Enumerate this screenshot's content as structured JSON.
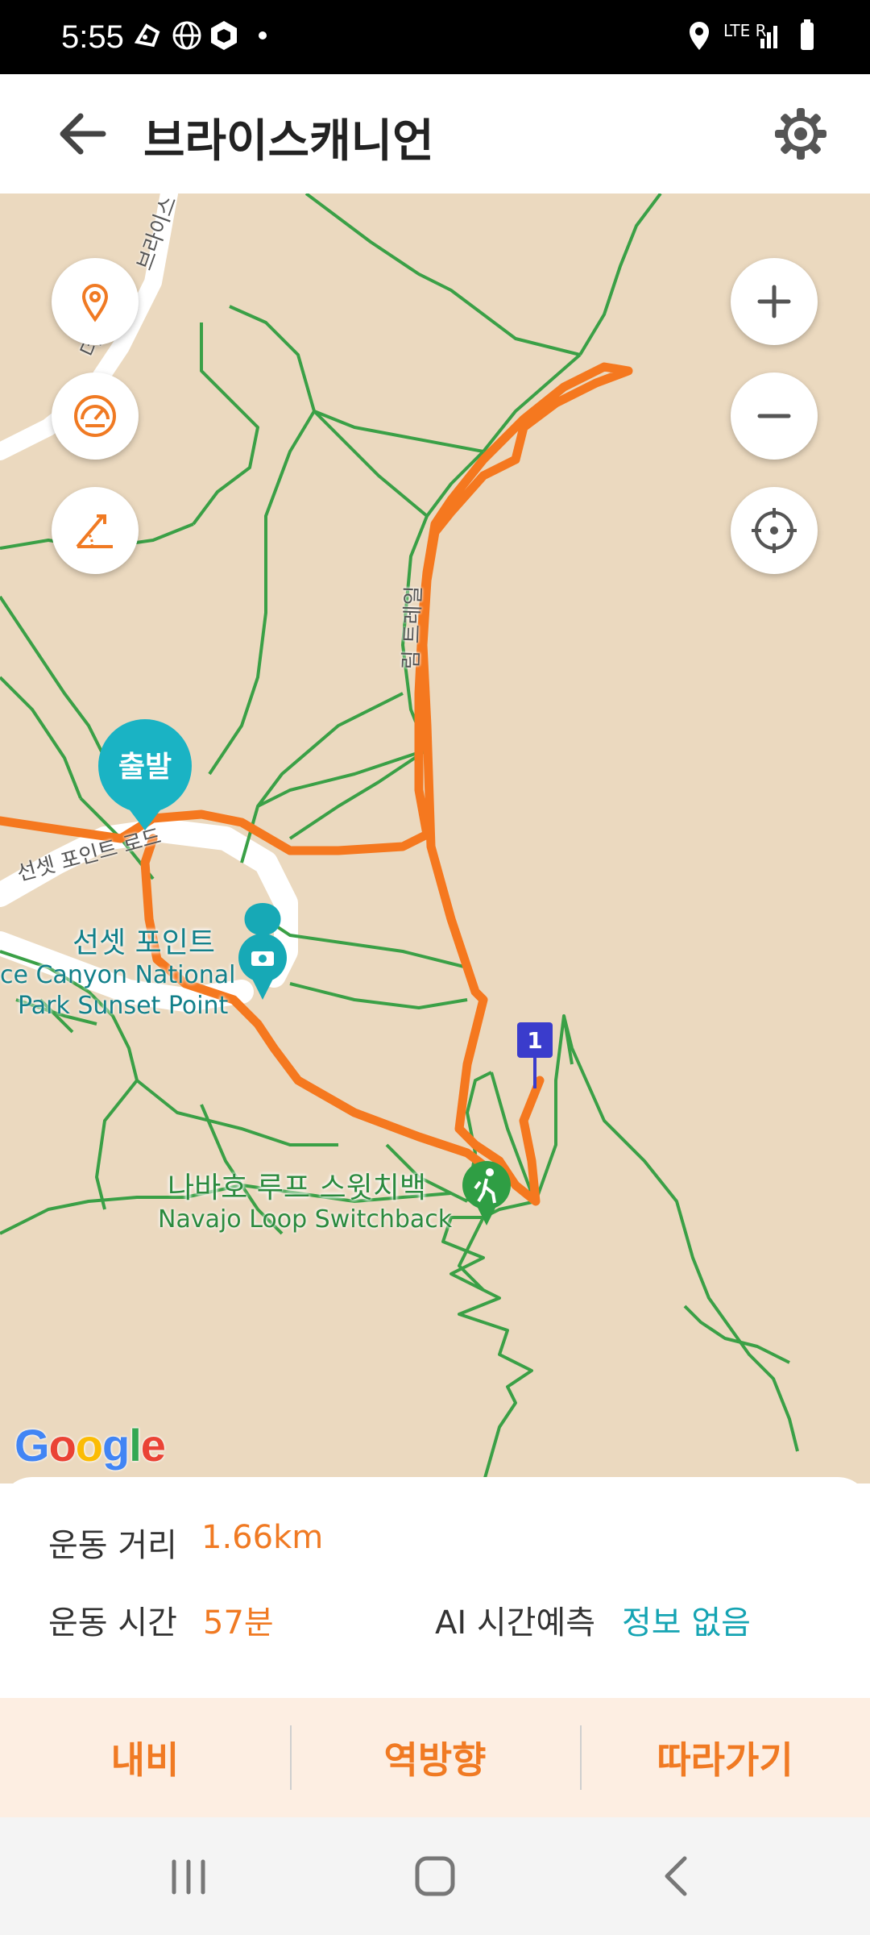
{
  "status_bar": {
    "time": "5:55",
    "left_icons": [
      "shoe-icon",
      "globe-icon",
      "cube-icon",
      "dot-icon"
    ],
    "right_icons": [
      "location-icon",
      "lte-signal-icon",
      "battery-icon"
    ],
    "network": "LTE R"
  },
  "app_bar": {
    "title": "브라이스캐니언",
    "back_icon": "arrow-left-icon",
    "settings_icon": "gear-icon"
  },
  "map": {
    "road_labels": [
      "브라이스",
      "더로",
      "림 트레일",
      "선셋 포인트 로드"
    ],
    "pois": [
      {
        "name_ko": "선셋 포인트",
        "name_en_1": "ce Canyon National",
        "name_en_2": "Park Sunset Point",
        "icon": "camera-icon"
      },
      {
        "name_ko": "나바호 루프 스윗치백",
        "name_en": "Navajo Loop Switchback",
        "icon": "hiker-icon"
      }
    ],
    "start_marker": "출발",
    "waypoint_number": "1",
    "attribution": "Google",
    "colors": {
      "route": "#f5781f",
      "trail": "#3aa046",
      "land": "#ebd9bf",
      "start": "#1ab3c4",
      "waypoint": "#3a3ccc"
    },
    "left_controls": [
      "location-pin-icon",
      "speedometer-icon",
      "elevation-icon"
    ],
    "right_controls": [
      "zoom-in-icon",
      "zoom-out-icon",
      "crosshair-icon"
    ]
  },
  "info": {
    "distance_label": "운동 거리",
    "distance_value": "1.66km",
    "time_label": "운동 시간",
    "time_value": "57분",
    "ai_label": "AI 시간예측",
    "ai_value": "정보 없음"
  },
  "actions": {
    "navi": "내비",
    "reverse": "역방향",
    "follow": "따라가기"
  },
  "nav_bar": [
    "recent-apps-icon",
    "home-icon",
    "back-icon"
  ]
}
